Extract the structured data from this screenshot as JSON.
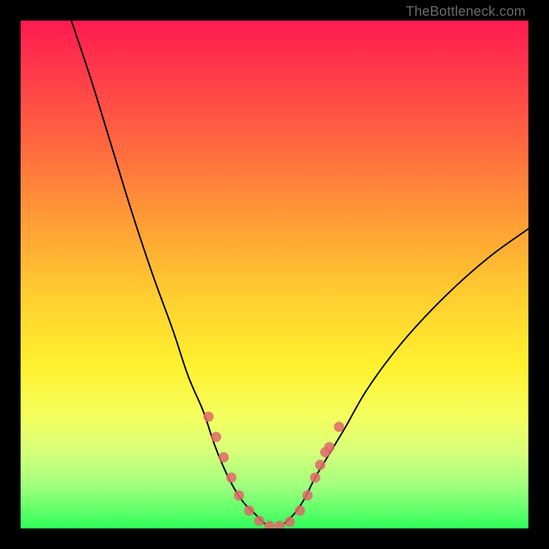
{
  "watermark": "TheBottleneck.com",
  "chart_data": {
    "type": "line",
    "title": "",
    "xlabel": "",
    "ylabel": "",
    "xlim": [
      0,
      100
    ],
    "ylim": [
      0,
      100
    ],
    "grid": false,
    "series": [
      {
        "name": "curve-left",
        "x": [
          10,
          14,
          18,
          22,
          26,
          30,
          33,
          36,
          38,
          40,
          42,
          44,
          46,
          48
        ],
        "values": [
          100,
          88,
          75,
          62,
          50,
          39,
          30,
          23,
          17,
          12,
          8,
          5,
          3,
          1
        ]
      },
      {
        "name": "curve-right",
        "x": [
          52,
          54,
          56,
          58,
          61,
          64,
          68,
          73,
          79,
          86,
          93,
          100
        ],
        "values": [
          1,
          3,
          6,
          10,
          15,
          20,
          27,
          34,
          41,
          48,
          54,
          59
        ]
      }
    ],
    "markers": [
      {
        "name": "dot",
        "x": 37.0,
        "y": 22.0
      },
      {
        "name": "dot",
        "x": 38.5,
        "y": 18.0
      },
      {
        "name": "dot",
        "x": 40.0,
        "y": 14.0
      },
      {
        "name": "dot",
        "x": 41.5,
        "y": 10.0
      },
      {
        "name": "dot",
        "x": 43.0,
        "y": 6.5
      },
      {
        "name": "dot",
        "x": 45.0,
        "y": 3.5
      },
      {
        "name": "dot",
        "x": 47.0,
        "y": 1.5
      },
      {
        "name": "dot",
        "x": 49.0,
        "y": 0.5
      },
      {
        "name": "dot",
        "x": 51.0,
        "y": 0.5
      },
      {
        "name": "dot",
        "x": 53.0,
        "y": 1.3
      },
      {
        "name": "dot",
        "x": 55.0,
        "y": 3.5
      },
      {
        "name": "dot",
        "x": 56.5,
        "y": 6.5
      },
      {
        "name": "dot",
        "x": 58.0,
        "y": 10.0
      },
      {
        "name": "dot",
        "x": 59.0,
        "y": 12.5
      },
      {
        "name": "dot",
        "x": 60.0,
        "y": 15.0
      },
      {
        "name": "dot",
        "x": 60.8,
        "y": 16.0
      },
      {
        "name": "dot",
        "x": 62.7,
        "y": 20.0
      }
    ],
    "colors": {
      "curve": "#000000",
      "marker": "#e06868",
      "gradient_top": "#ff1a50",
      "gradient_mid": "#fff12e",
      "gradient_bottom": "#2fff5a",
      "frame": "#000000"
    }
  }
}
